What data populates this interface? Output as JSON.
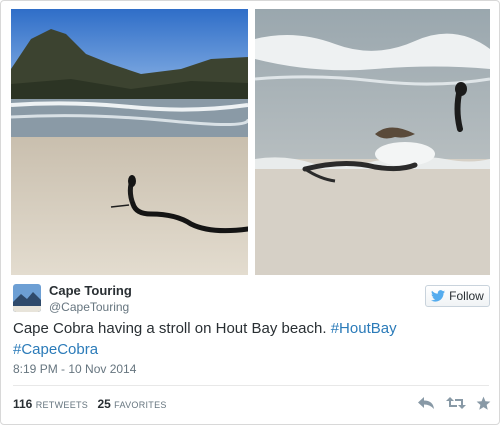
{
  "tweet": {
    "author_name": "Cape Touring",
    "author_handle": "@CapeTouring",
    "text_plain": "Cape Cobra having a stroll on Hout Bay beach.",
    "hashtags": [
      "#HoutBay",
      "#CapeCobra"
    ],
    "timestamp": "8:19 PM - 10 Nov 2014",
    "retweets_count": "116",
    "retweets_label": "RETWEETS",
    "favorites_count": "25",
    "favorites_label": "FAVORITES"
  },
  "follow_button": {
    "label": "Follow",
    "icon": "twitter-bird-icon"
  },
  "actions": {
    "reply_icon": "reply-icon",
    "retweet_icon": "retweet-icon",
    "favorite_icon": "star-icon"
  },
  "colors": {
    "link": "#2b7bb9",
    "text": "#292f33",
    "muted": "#66757f",
    "bird": "#55acee"
  }
}
